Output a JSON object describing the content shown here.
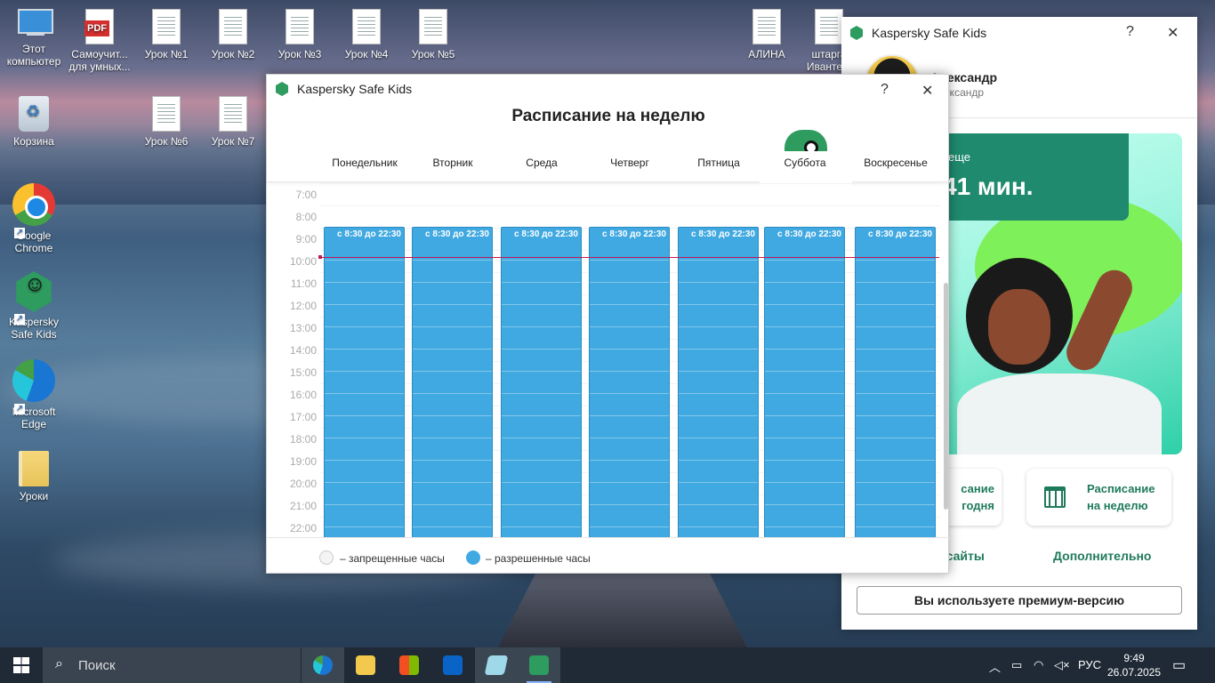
{
  "desktop": {
    "icons": [
      {
        "label": "Этот компьютер"
      },
      {
        "label": "Самоучит... для умных..."
      },
      {
        "label": "Урок №1"
      },
      {
        "label": "Урок №2"
      },
      {
        "label": "Урок №3"
      },
      {
        "label": "Урок №4"
      },
      {
        "label": "Урок №5"
      },
      {
        "label": "Корзина"
      },
      {
        "label": "Урок №6"
      },
      {
        "label": "Урок №7"
      },
      {
        "label": "Google Chrome"
      },
      {
        "label": "Kaspersky Safe Kids"
      },
      {
        "label": "Microsoft Edge"
      },
      {
        "label": "Уроки"
      },
      {
        "label": "АЛИНА"
      },
      {
        "label": "штарга Иванте..."
      }
    ],
    "pdf_badge": "PDF"
  },
  "main_window": {
    "app_title": "Kaspersky Safe Kids",
    "help": "?",
    "close": "✕",
    "profile": {
      "name": "Александр",
      "sub": "Александр"
    },
    "remaining_label": "еще",
    "remaining_value": "41 мин.",
    "tile_today": "Расписание на сегодня",
    "tile_today_visible": "сание\nгодня",
    "tile_week": "Расписание на неделю",
    "link_sites": "е сайты",
    "link_more": "Дополнительно",
    "premium": "Вы используете премиум-версию"
  },
  "schedule_window": {
    "app_title": "Kaspersky Safe Kids",
    "help": "?",
    "close": "✕",
    "title": "Расписание на неделю",
    "days": [
      "Понедельник",
      "Вторник",
      "Среда",
      "Четверг",
      "Пятница",
      "Суббота",
      "Воскресенье"
    ],
    "selected_day": "Суббота",
    "hours": [
      "7:00",
      "8:00",
      "9:00",
      "10:00",
      "11:00",
      "12:00",
      "13:00",
      "14:00",
      "15:00",
      "16:00",
      "17:00",
      "18:00",
      "19:00",
      "20:00",
      "21:00",
      "22:00"
    ],
    "allowed_range": "с 8:30 до 22:30",
    "legend_forbidden": "– запрещенные часы",
    "legend_allowed": "– разрешенные часы",
    "colors": {
      "allowed": "#41a9e1",
      "now_line": "#c2185b"
    }
  },
  "taskbar": {
    "search_placeholder": "Поиск",
    "language": "РУС",
    "time": "9:49",
    "date": "26.07.2025"
  }
}
